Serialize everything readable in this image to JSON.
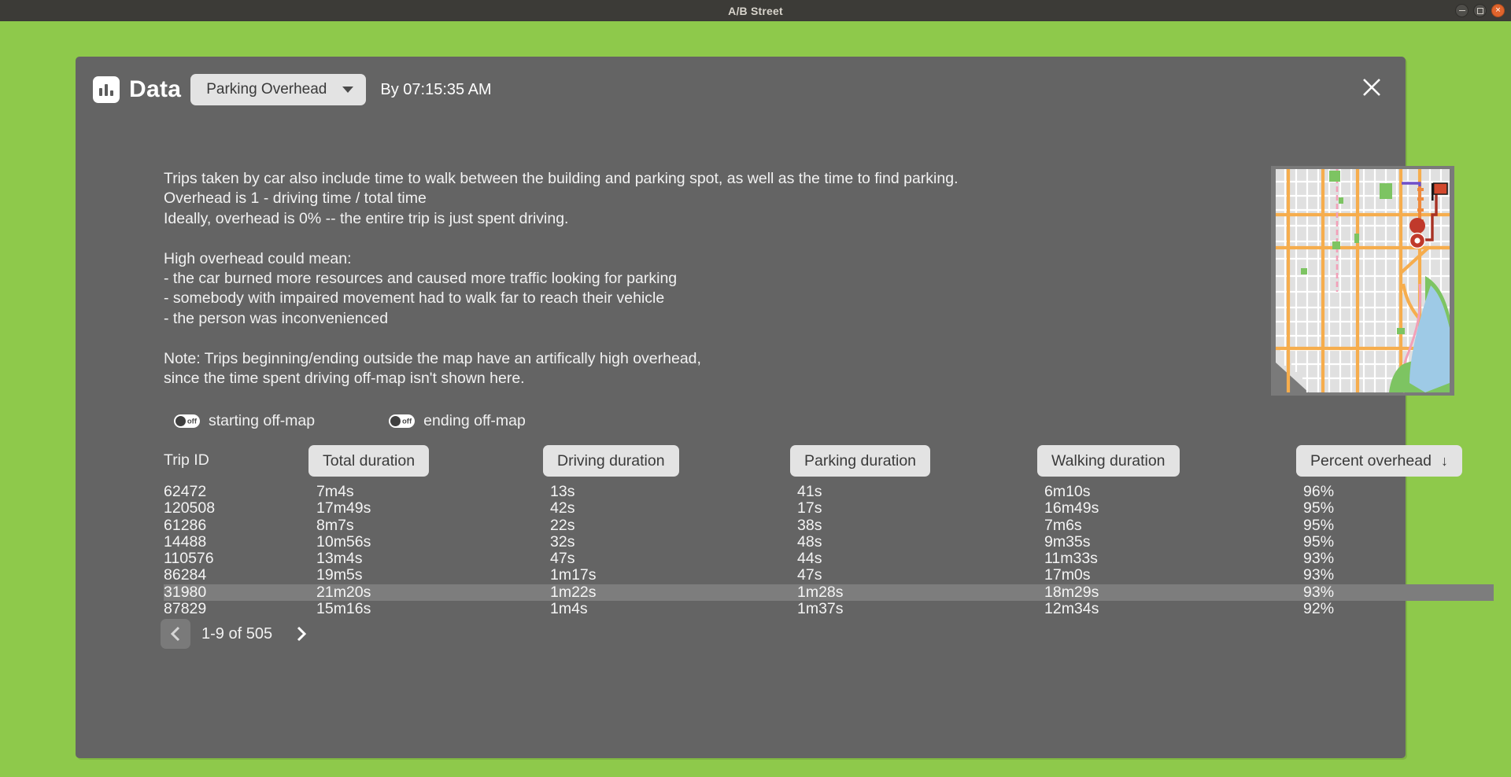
{
  "window": {
    "title": "A/B Street",
    "controls": [
      {
        "name": "minimize",
        "icon": "minimize-icon"
      },
      {
        "name": "maximize",
        "icon": "maximize-icon"
      },
      {
        "name": "close",
        "icon": "close-icon",
        "color": "#e0642c"
      }
    ]
  },
  "theme": {
    "desktop_bg": "#8ec94b",
    "panel_bg": "#646464",
    "button_bg": "#e3e3e3",
    "text": "#f2f2f2",
    "row_highlight": "#7d7d7d"
  },
  "panel": {
    "icon": "bar-chart-icon",
    "title": "Data",
    "dataset_dropdown": {
      "value": "Parking Overhead",
      "caret": "chevron-down-icon"
    },
    "time_label": "By 07:15:35 AM",
    "close_label": "×"
  },
  "description": "Trips taken by car also include time to walk between the building and parking spot, as well as the time to find parking.\nOverhead is 1 - driving time / total time\nIdeally, overhead is 0% -- the entire trip is just spent driving.\n\nHigh overhead could mean:\n- the car burned more resources and caused more traffic looking for parking\n- somebody with impaired movement had to walk far to reach their vehicle\n- the person was inconvenienced\n\nNote: Trips beginning/ending outside the map have an artifically high overhead,\nsince the time spent driving off-map isn't shown here.",
  "filters": [
    {
      "label": "starting off-map",
      "state": "off"
    },
    {
      "label": "ending off-map",
      "state": "off"
    }
  ],
  "table": {
    "headers": [
      {
        "label": "Trip ID",
        "type": "plain"
      },
      {
        "label": "Total duration",
        "type": "button"
      },
      {
        "label": "Driving duration",
        "type": "button"
      },
      {
        "label": "Parking duration",
        "type": "button"
      },
      {
        "label": "Walking duration",
        "type": "button"
      },
      {
        "label": "Percent overhead",
        "type": "button",
        "sort": "↓"
      }
    ],
    "rows": [
      {
        "highlight": false,
        "cells": [
          "62472",
          "7m4s",
          "13s",
          "41s",
          "6m10s",
          "96%"
        ]
      },
      {
        "highlight": false,
        "cells": [
          "120508",
          "17m49s",
          "42s",
          "17s",
          "16m49s",
          "95%"
        ]
      },
      {
        "highlight": false,
        "cells": [
          "61286",
          "8m7s",
          "22s",
          "38s",
          "7m6s",
          "95%"
        ]
      },
      {
        "highlight": false,
        "cells": [
          "14488",
          "10m56s",
          "32s",
          "48s",
          "9m35s",
          "95%"
        ]
      },
      {
        "highlight": false,
        "cells": [
          "110576",
          "13m4s",
          "47s",
          "44s",
          "11m33s",
          "93%"
        ]
      },
      {
        "highlight": false,
        "cells": [
          "86284",
          "19m5s",
          "1m17s",
          "47s",
          "17m0s",
          "93%"
        ]
      },
      {
        "highlight": true,
        "cells": [
          "31980",
          "21m20s",
          "1m22s",
          "1m28s",
          "18m29s",
          "93%"
        ]
      },
      {
        "highlight": false,
        "cells": [
          "87829",
          "15m16s",
          "1m4s",
          "1m37s",
          "12m34s",
          "92%"
        ]
      }
    ]
  },
  "pagination": {
    "prev_icon": "chevron-left-icon",
    "next_icon": "chevron-right-icon",
    "label": "1-9 of 505"
  },
  "minimap": {
    "name": "minimap-thumbnail",
    "markers": [
      "destination-flag",
      "location-pin"
    ]
  }
}
